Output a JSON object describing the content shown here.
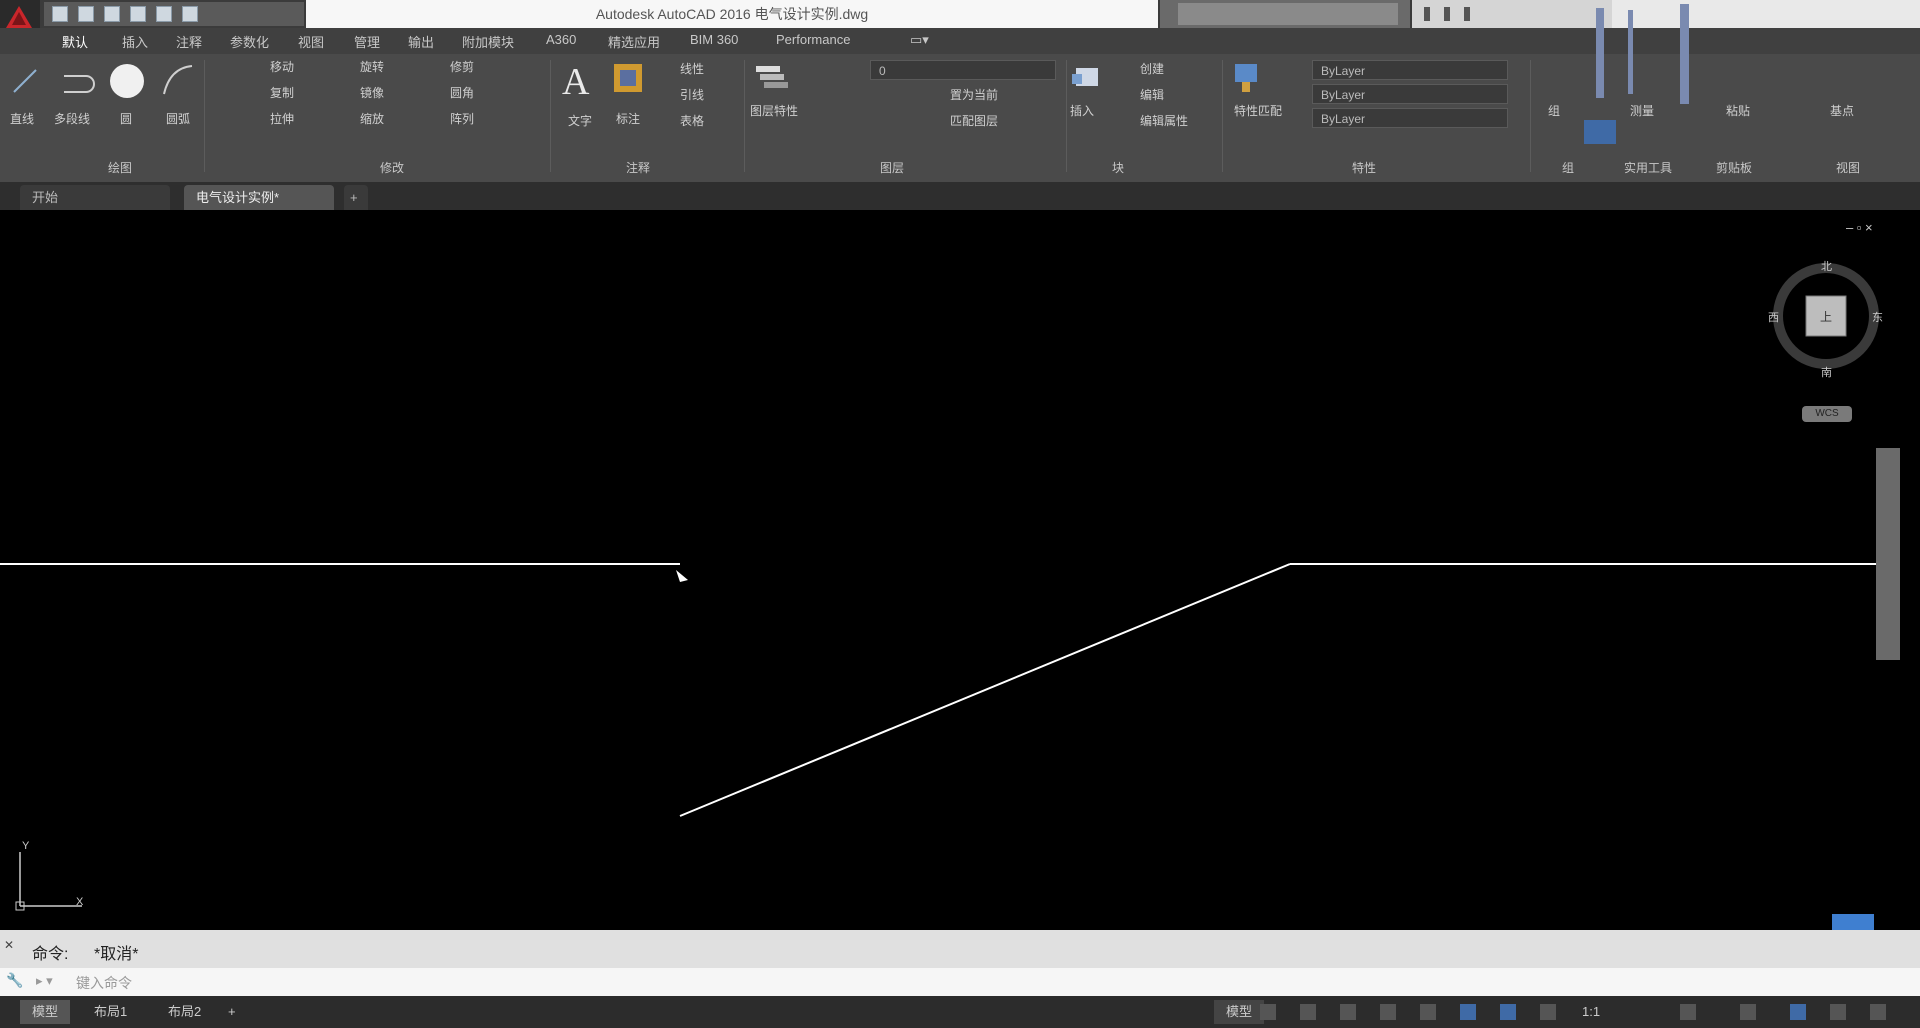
{
  "window": {
    "title": "Autodesk AutoCAD 2016   电气设计实例.dwg"
  },
  "ribbon_tabs": [
    "默认",
    "插入",
    "注释",
    "参数化",
    "视图",
    "管理",
    "输出",
    "附加模块",
    "A360",
    "精选应用",
    "BIM 360",
    "Performance"
  ],
  "ribbon": {
    "draw": {
      "line": "直线",
      "polyline": "多段线",
      "circle": "圆",
      "arc": "圆弧",
      "panel_label": "绘图"
    },
    "modify": {
      "move": "移动",
      "rotate": "旋转",
      "trim": "修剪",
      "copy": "复制",
      "mirror": "镜像",
      "fillet": "圆角",
      "stretch": "拉伸",
      "scale": "缩放",
      "array": "阵列",
      "panel_label": "修改"
    },
    "annotation": {
      "text": "文字",
      "dimension": "标注",
      "linear": "线性",
      "leader": "引线",
      "table": "表格",
      "panel_label": "注释"
    },
    "layers": {
      "layer_properties": "图层特性",
      "layer_combo_value": "0",
      "make_current": "置为当前",
      "match_layer": "匹配图层",
      "panel_label": "图层"
    },
    "block": {
      "insert": "插入",
      "create": "创建",
      "edit": "编辑",
      "edit_attributes": "编辑属性",
      "panel_label": "块"
    },
    "properties": {
      "match_properties": "特性匹配",
      "color": "ByLayer",
      "linetype": "ByLayer",
      "lineweight": "ByLayer",
      "panel_label": "特性"
    },
    "groups": {
      "group": "组",
      "panel_label": "组"
    },
    "utilities": {
      "measure": "测量",
      "panel_label": "实用工具"
    },
    "clipboard": {
      "paste": "粘贴",
      "panel_label": "剪贴板"
    },
    "view": {
      "base": "基点",
      "panel_label": "视图"
    }
  },
  "file_tabs": [
    {
      "label": "开始"
    },
    {
      "label": "电气设计实例*"
    }
  ],
  "viewport": {
    "controls": "– ▫ ×",
    "viewcube": {
      "north": "北",
      "south": "南",
      "east": "东",
      "west": "西",
      "top": "上",
      "wcs": "WCS"
    }
  },
  "drawing": {
    "line_color": "#ffffff"
  },
  "ucs": {
    "y": "Y",
    "x": "X"
  },
  "command": {
    "history_prompt": "命令:",
    "history_text": "*取消*",
    "input_placeholder": "键入命令"
  },
  "layout_tabs": [
    "模型",
    "布局1",
    "布局2"
  ],
  "status": {
    "model_label": "模型",
    "scale": "1:1"
  }
}
